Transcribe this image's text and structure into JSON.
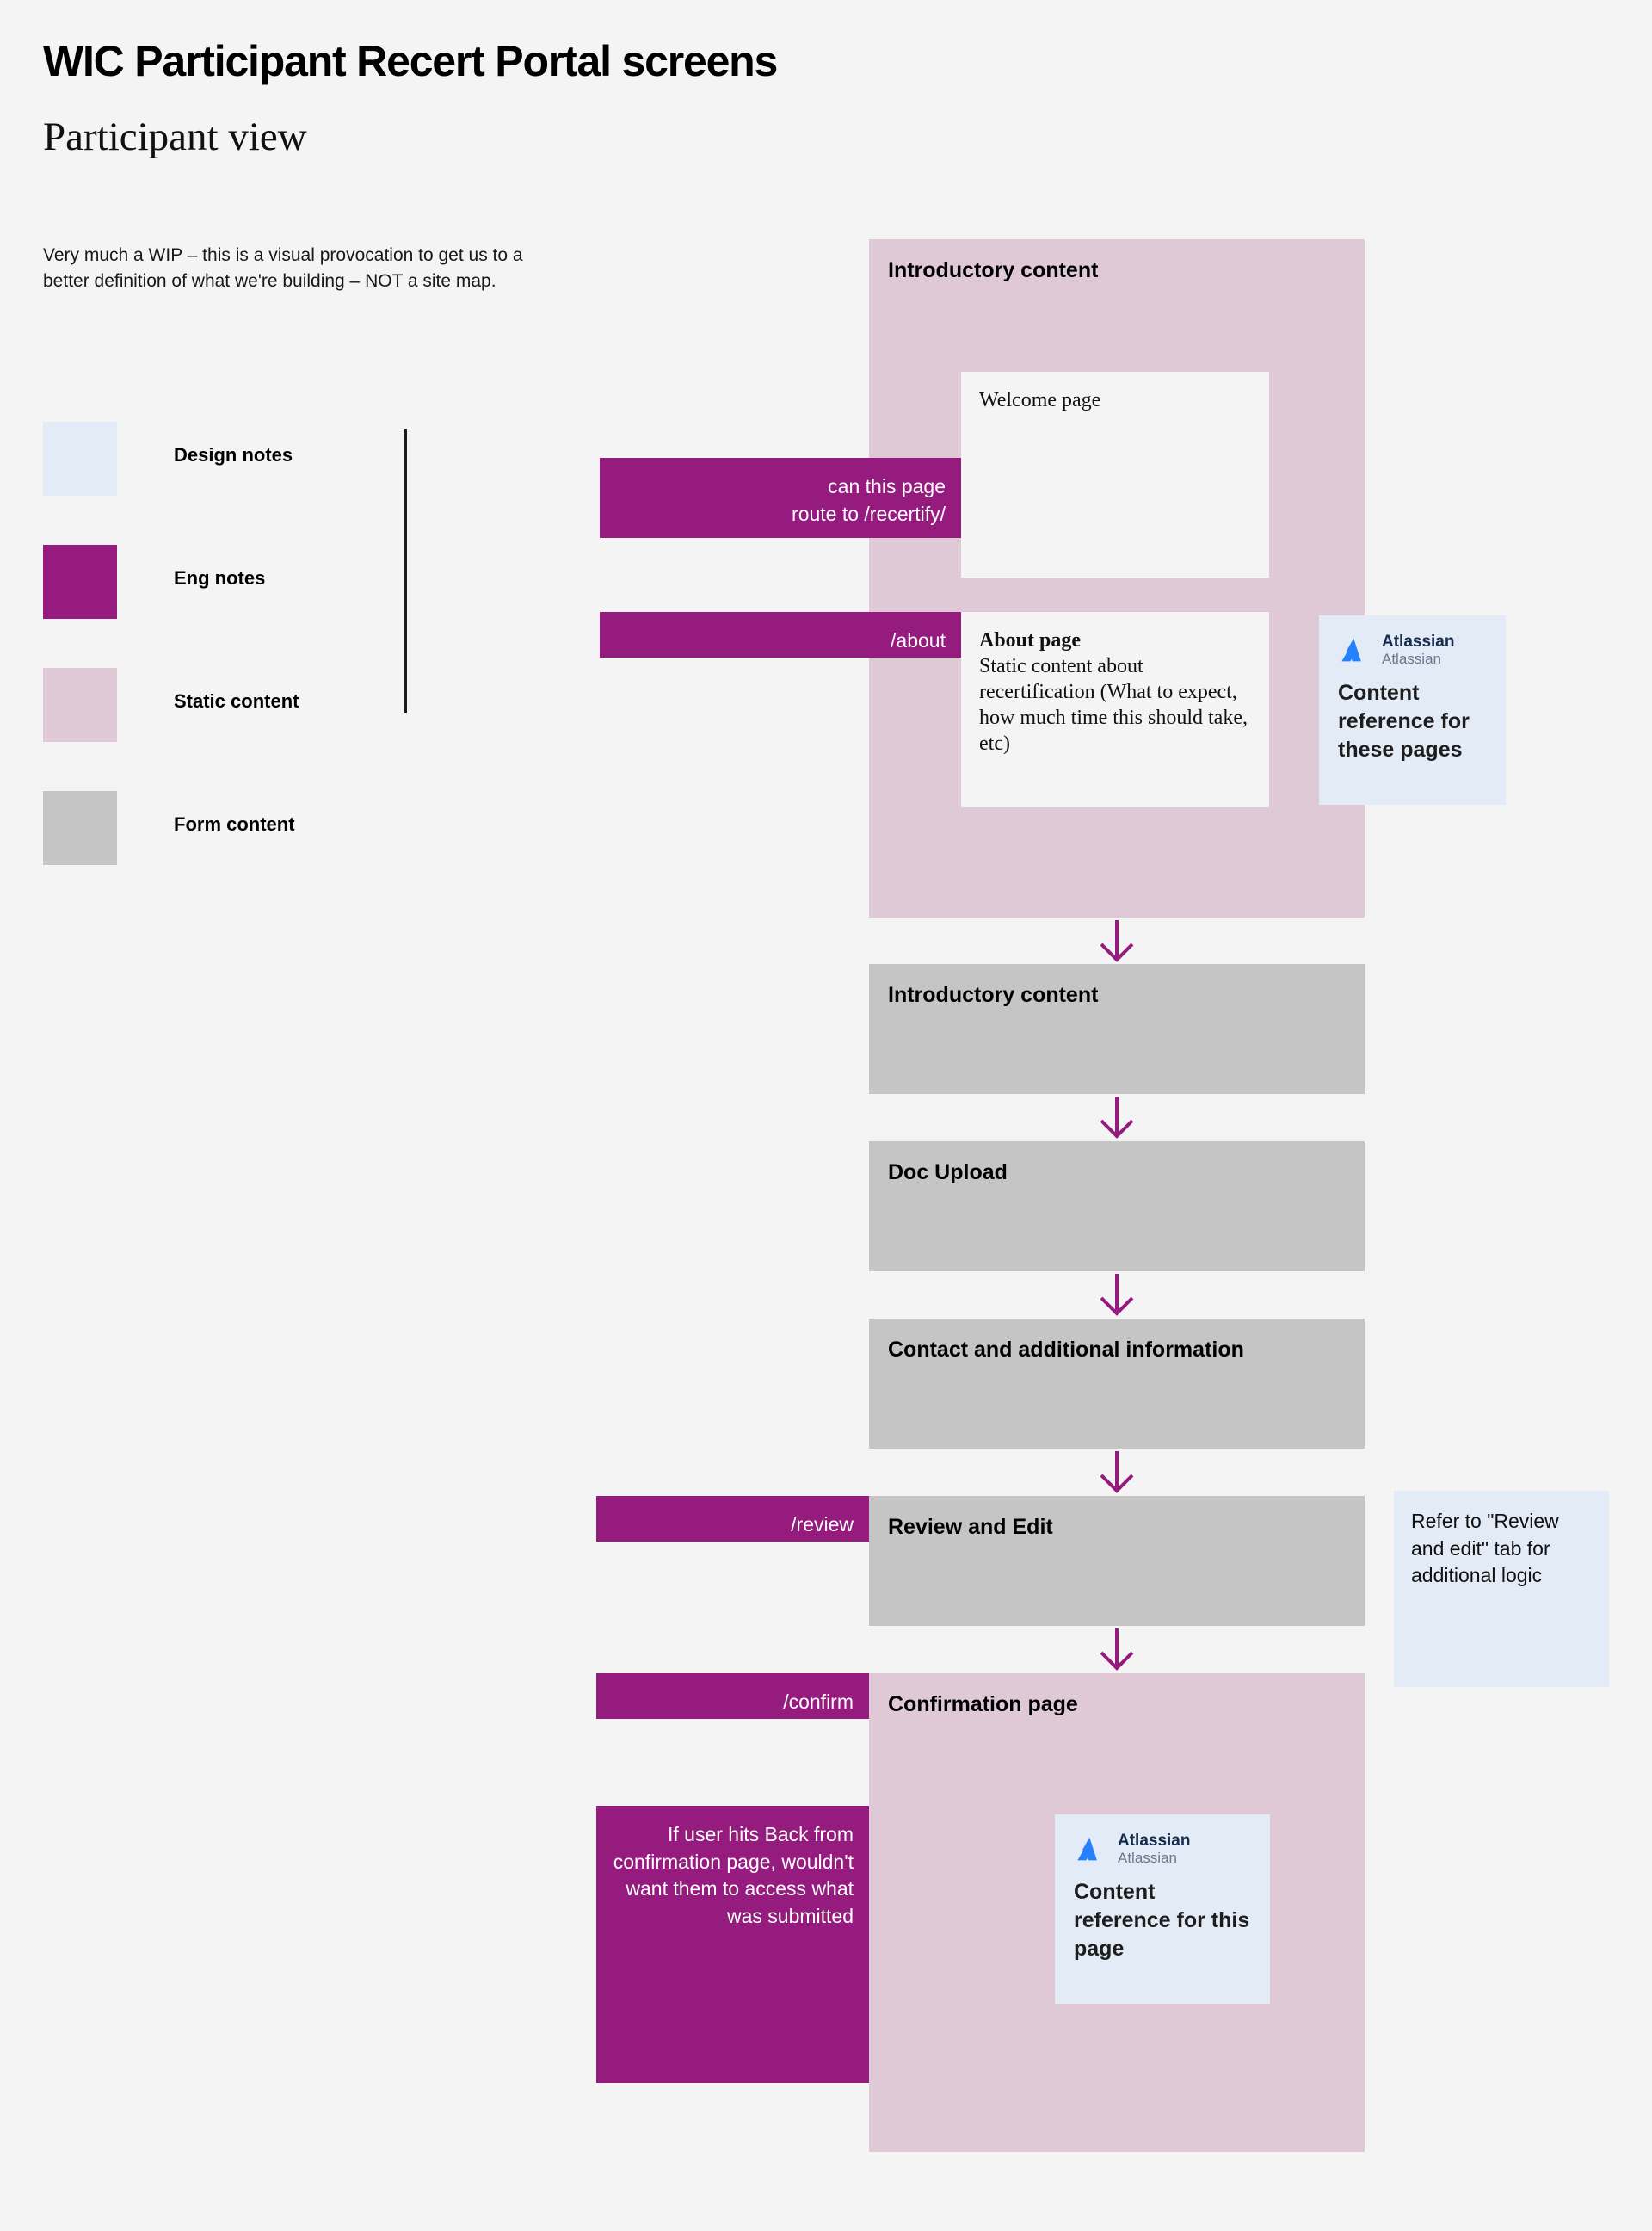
{
  "header": {
    "title": "WIC Participant Recert Portal screens",
    "subtitle": "Participant view",
    "description": "Very much a WIP – this is a visual provocation to get us to a better definition of what we're building – NOT a site map."
  },
  "legend": {
    "items": [
      {
        "label": "Design notes",
        "color": "#e3ebf6"
      },
      {
        "label": "Eng notes",
        "color": "#961b7f"
      },
      {
        "label": "Static content",
        "color": "#e0c9d7"
      },
      {
        "label": "Form content",
        "color": "#c5c5c5"
      }
    ]
  },
  "flow": {
    "intro_static": {
      "title": "Introductory content",
      "welcome_card": {
        "title": "Welcome page"
      },
      "about_card": {
        "heading": "About page",
        "body": "Static content about recertification (What to expect, how much time this should take, etc)"
      }
    },
    "intro_form": {
      "title": "Introductory content"
    },
    "doc_upload": {
      "title": "Doc Upload"
    },
    "contact": {
      "title": "Contact and additional information"
    },
    "review": {
      "title": "Review and Edit"
    },
    "confirmation": {
      "title": "Confirmation page"
    }
  },
  "eng_notes": [
    {
      "id": "recertify-route",
      "text": "can this page\nroute to /recertify/"
    },
    {
      "id": "about-route",
      "text": "/about"
    },
    {
      "id": "review-route",
      "text": "/review"
    },
    {
      "id": "confirm-route",
      "text": "/confirm"
    },
    {
      "id": "back-button",
      "text": "If user hits Back from confirmation page, wouldn't want them to access what was submitted"
    }
  ],
  "design_notes": [
    {
      "id": "review-tab",
      "text": "Refer to \"Review and edit\" tab for additional logic"
    }
  ],
  "atlassian_cards": [
    {
      "id": "intro-ref",
      "brand": "Atlassian",
      "space": "Atlassian",
      "title": "Content reference for these pages"
    },
    {
      "id": "confirm-ref",
      "brand": "Atlassian",
      "space": "Atlassian",
      "title": "Content reference for this page"
    }
  ],
  "colors": {
    "background": "#f4f4f4",
    "eng_note": "#961b7f",
    "static_content": "#e0c9d7",
    "form_content": "#c5c5c5",
    "design_note": "#e3ebf6",
    "arrow": "#961b7f",
    "atlassian_blue": "#2681ff"
  }
}
